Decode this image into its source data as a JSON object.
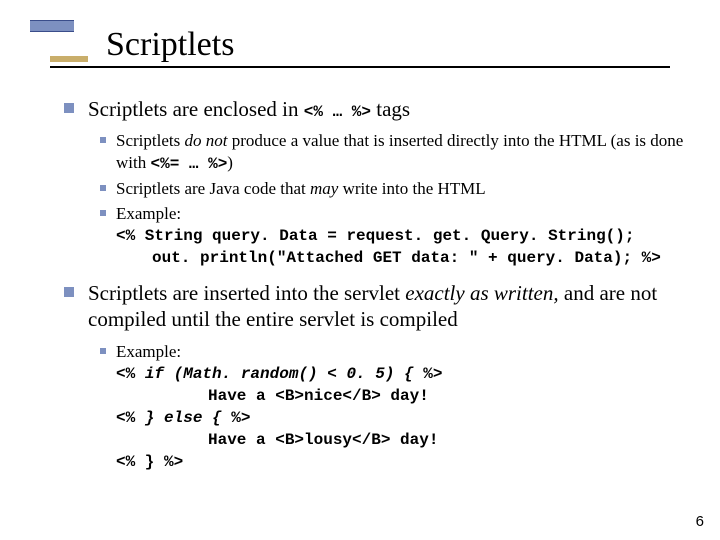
{
  "title": "Scriptlets",
  "b1": {
    "pre": "Scriptlets are enclosed in ",
    "code": "<% … %>",
    "post": " tags",
    "sub": {
      "s1a": "Scriptlets ",
      "s1b": "do not",
      "s1c": " produce a value that is inserted directly into the HTML (as is done with ",
      "s1d": "<%= … %>",
      "s1e": ")",
      "s2a": "Scriptlets are Java code that ",
      "s2b": "may",
      "s2c": " write into the HTML",
      "s3": "Example:",
      "c1": "<% String query. Data = request. get. Query. String();",
      "c2": "out. println(\"Attached GET data: \" + query. Data); %>"
    }
  },
  "b2": {
    "pre": "Scriptlets are inserted into the servlet ",
    "mid": "exactly as written,",
    "post": " and are not compiled until the entire servlet is compiled",
    "sub": {
      "s1": "Example:",
      "c1a": "<% ",
      "c1b": "if (Math. random() < 0. 5) {",
      "c1c": " %>",
      "c2a": "Have a <B>nice</B> day!",
      "c3a": "<% ",
      "c3b": "} else {",
      "c3c": " %>",
      "c4a": "Have a <B>lousy</B> day!",
      "c5": "<% } %>"
    }
  },
  "page": "6"
}
